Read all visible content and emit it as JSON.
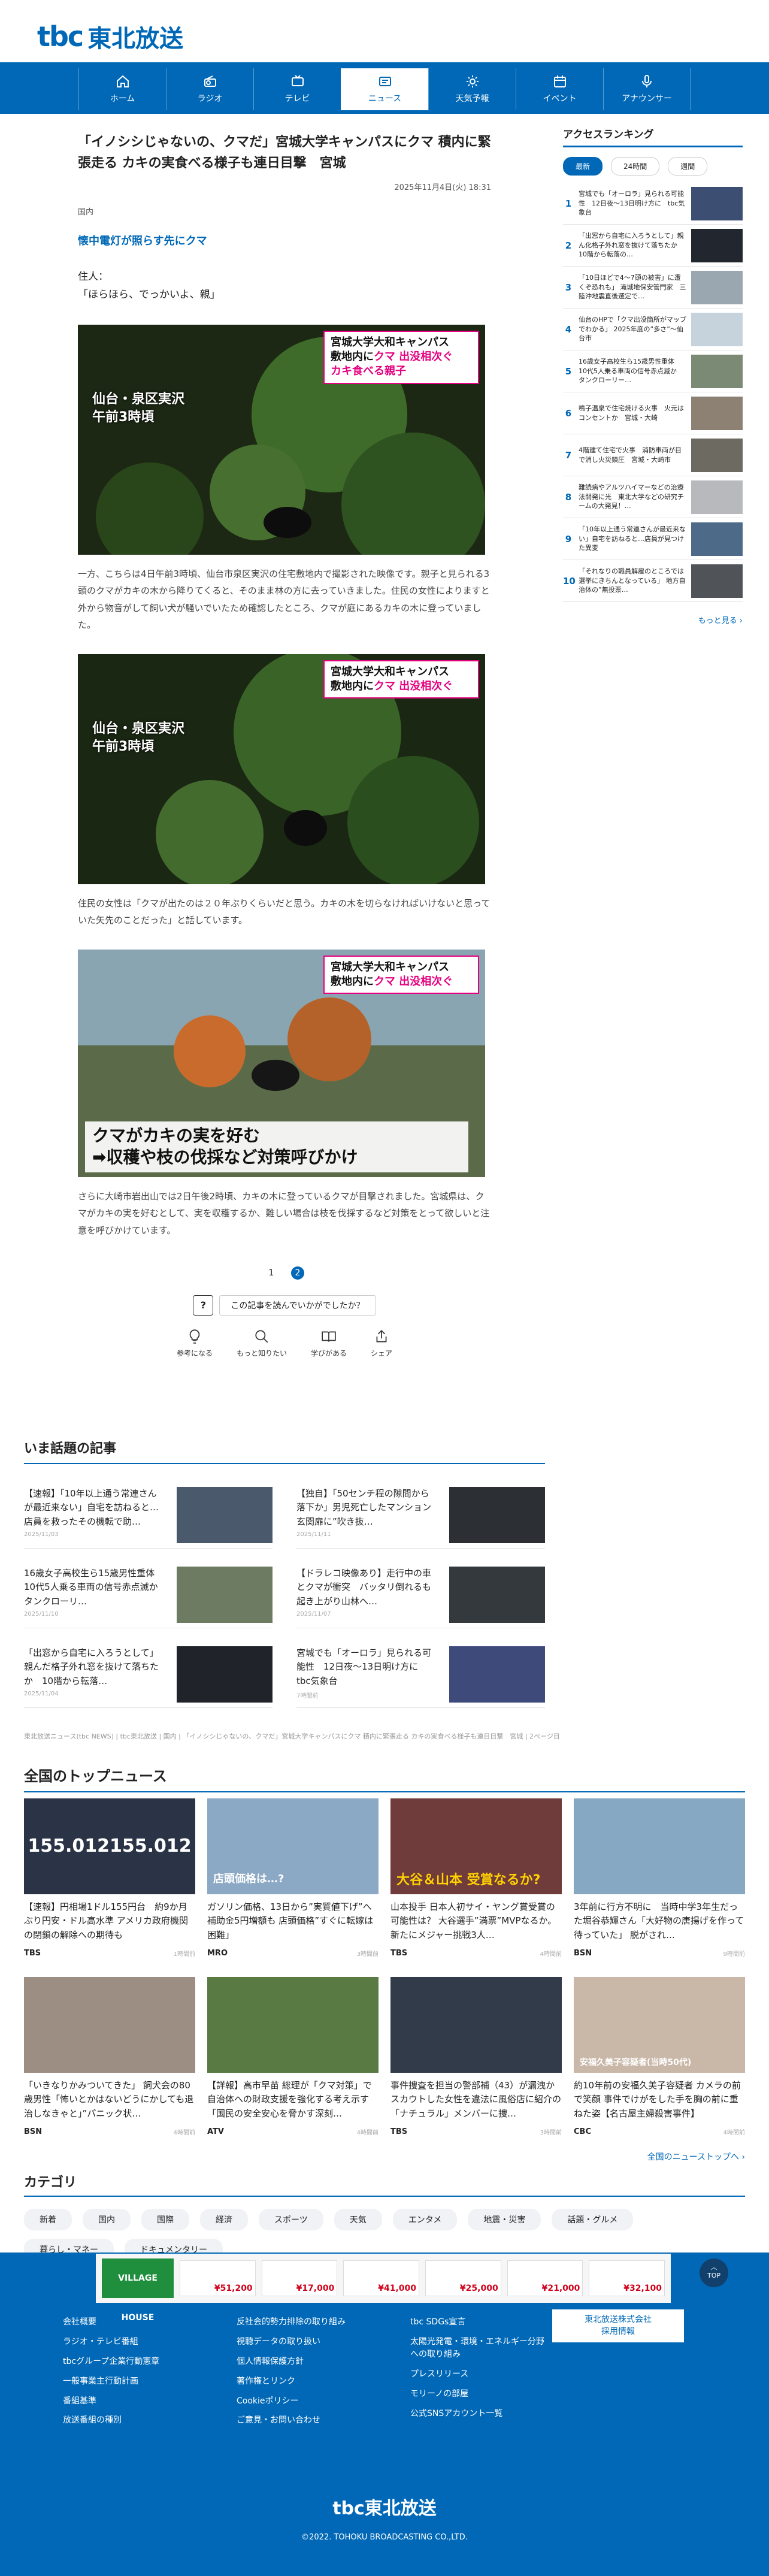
{
  "header": {
    "logo_mark": "tbc",
    "logo_text": "東北放送"
  },
  "nav": [
    {
      "label": "ホーム",
      "icon": "home-icon"
    },
    {
      "label": "ラジオ",
      "icon": "radio-icon"
    },
    {
      "label": "テレビ",
      "icon": "tv-icon"
    },
    {
      "label": "ニュース",
      "icon": "news-icon",
      "active": true
    },
    {
      "label": "天気予報",
      "icon": "weather-icon"
    },
    {
      "label": "イベント",
      "icon": "event-icon"
    },
    {
      "label": "アナウンサー",
      "icon": "mic-icon"
    }
  ],
  "article": {
    "title": "「イノシシじゃないの、クマだ」宮城大学キャンパスにクマ 積内に緊張走る カキの実食べる様子も連日目撃　宮城",
    "date": "2025年11月4日(火) 18:31",
    "category": "国内",
    "subhead": "懐中電灯が照らす先にクマ",
    "speech": "住人：\n「ほらほら、でっかいよ、親」",
    "photo_caption_1": "宮城大学大和キャンパス",
    "photo_caption_2_prefix": "敷地内に",
    "photo_caption_2_hl": "クマ 出没相次ぐ",
    "photo_caption_3": "カキ食べる親子",
    "photo_location": "仙台・泉区実沢\n午前3時頃",
    "para1": "一方、こちらは4日午前3時頃、仙台市泉区実沢の住宅敷地内で撮影された映像です。親子と見られる3頭のクマがカキの木から降りてくると、そのまま林の方に去っていきました。住民の女性によりますと外から物音がして飼い犬が騒いでいたため確認したところ、クマが庭にあるカキの木に登っていました。",
    "para2": "住民の女性は「クマが出たのは２０年ぶりくらいだと思う。カキの木を切らなければいけないと思っていた矢先のことだった」と話しています。",
    "photo3_caption": "クマがカキの実を好む\n➡収穫や枝の伐採など対策呼びかけ",
    "para3": "さらに大崎市岩出山では2日午後2時頃、カキの木に登っているクマが目撃されました。宮城県は、クマがカキの実を好むとして、実を収穫するか、難しい場合は枝を伐採するなど対策をとって欲しいと注意を呼びかけています。",
    "pages": [
      "1",
      "2"
    ],
    "ask_label": "この記事を読んでいかがでしたか？",
    "reactions": [
      {
        "label": "参考になる",
        "icon": "lightbulb-icon"
      },
      {
        "label": "もっと知りたい",
        "icon": "magnifier-icon"
      },
      {
        "label": "学びがある",
        "icon": "book-icon"
      },
      {
        "label": "シェア",
        "icon": "share-icon"
      }
    ]
  },
  "ranking": {
    "title": "アクセスランキング",
    "tabs": [
      "最新",
      "24時間",
      "週間"
    ],
    "items": [
      {
        "rank": "1",
        "text": "宮城でも「オーロラ」見られる可能性　12日夜〜13日明け方に　tbc気象台"
      },
      {
        "rank": "2",
        "text": "「出窓から自宅に入ろうとして」親ん化格子外れ窓を抜けて落ちたか　10階から転落の…"
      },
      {
        "rank": "3",
        "text": "「10日ほどで4〜7頭の被害」に遭くぞ恐れも」 滝城地保安管門家　三陸沖地震直後選定で…"
      },
      {
        "rank": "4",
        "text": "仙台のHPで「クマ出没箇所がマップでわかる」 2025年度の”多さ”〜仙台市"
      },
      {
        "rank": "5",
        "text": "16歳女子高校生ら15歳男性重体　10代5人乗る車両の信号赤点滅か　タンクローリー…"
      },
      {
        "rank": "6",
        "text": "鳴子温泉で住宅焼ける火事　火元はコンセントか　宮城・大崎"
      },
      {
        "rank": "7",
        "text": "4階建て住宅で火事　消防車両が目で消し火災鎮圧　宮城・大崎市"
      },
      {
        "rank": "8",
        "text": "難読病やアルツハイマーなどの治療法開発に光　東北大学などの研究チームの大発見！…"
      },
      {
        "rank": "9",
        "text": "「10年以上通う常連さんが最近来ない」自宅を訪ねると…店員が見つけた異変"
      },
      {
        "rank": "10",
        "text": "「それなりの職員解雇のところでは選挙にきちんとなっている」 地方自治体の”無投票…"
      }
    ],
    "more": "もっと見る ›"
  },
  "hot": {
    "title": "いま話題の記事",
    "items": [
      {
        "text": "【速報】「10年以上通う常連さんが最近来ない」自宅を訪ねると…店員を救ったその機転で助…",
        "date": "2025/11/03"
      },
      {
        "text": "【独自】「50センチ程の隙間から落下か」男児死亡したマンション 玄関扉に”吹き抜…",
        "date": "2025/11/11"
      },
      {
        "text": "16歳女子高校生ら15歳男性重体　10代5人乗る車両の信号赤点滅か　タンクローリ…",
        "date": "2025/11/10"
      },
      {
        "text": "【ドラレコ映像あり】走行中の車とクマが衝突　バッタリ倒れるも起き上がり山林へ…",
        "date": "2025/11/07"
      },
      {
        "text": "「出窓から自宅に入ろうとして」親んだ格子外れ窓を抜けて落ちたか　10階から転落…",
        "date": "2025/11/04"
      },
      {
        "text": "宮城でも「オーロラ」見られる可能性　12日夜〜13日明け方に　tbc気象台",
        "date": "7時間前"
      }
    ]
  },
  "breadcrumb": "東北放送ニュース(tbc NEWS) | tbc東北放送 | 国内 | 「イノシシじゃないの、クマだ」宮城大学キャンパスにクマ 積内に緊張走る カキの実食べる様子も連日目撃　宮城 | 2ページ目",
  "top_news": {
    "title": "全国のトップニュース",
    "items": [
      {
        "text": "【速報】円相場1ドル155円台　約9か月ぶり円安・ドル高水準 アメリカ政府機関の閉鎖の解除への期待も",
        "source": "TBS",
        "date": "1時間前",
        "thumb_text": "155.012155.012"
      },
      {
        "text": "ガソリン価格、13日から”実質値下げ”へ 補助金5円増額も 店頭価格”すぐに転嫁は困難」",
        "source": "MRO",
        "date": "3時間前",
        "thumb_text": "店頭価格は…?"
      },
      {
        "text": "山本投手 日本人初サイ・ヤング賞受賞の可能性は？ 大谷選手”満票”MVPなるか。新たにメジャー挑戦3人…",
        "source": "TBS",
        "date": "4時間前",
        "thumb_text": "大谷＆山本 受賞なるか?"
      },
      {
        "text": "3年前に行方不明に　当時中学3年生だった堀谷恭輝さん「大好物の唐揚げを作って待っていた」 脱がされ…",
        "source": "BSN",
        "date": "9時間前",
        "thumb_text": ""
      },
      {
        "text": "「いきなりかみついてきた」 飼犬会の80歳男性「怖いとかはないどうにかしても退治しなきゃと」”パニック状…",
        "source": "BSN",
        "date": "4時間前",
        "thumb_text": ""
      },
      {
        "text": "【詳報】高市早苗 総理が「クマ対策」で自治体への財政支援を強化する考え示す「国民の安全安心を脅かす深刻…",
        "source": "ATV",
        "date": "4時間前",
        "thumb_text": ""
      },
      {
        "text": "事件捜査を担当の警部補（43）が漏洩か スカウトした女性を違法に風俗店に紹介の「ナチュラル」メンバーに捜…",
        "source": "TBS",
        "date": "3時間前",
        "thumb_text": ""
      },
      {
        "text": "約10年前の安福久美子容疑者 カメラの前で笑顔 事件でけがをした手を胸の前に重ねた姿【名古屋主婦殺害事件】",
        "source": "CBC",
        "date": "4時間前",
        "thumb_text": "安福久美子容疑者(当時50代)"
      }
    ],
    "more": "全国のニューストップへ ›"
  },
  "categories": {
    "title": "カテゴリ",
    "items": [
      "新着",
      "国内",
      "国際",
      "経済",
      "スポーツ",
      "天気",
      "エンタメ",
      "地震・災害",
      "話題・グルメ",
      "暮らし・マネー",
      "ドキュメンタリー"
    ]
  },
  "ad": {
    "logo": "VILLAGE HOUSE",
    "prices": [
      "¥51,200",
      "¥17,000",
      "¥41,000",
      "¥25,000",
      "¥21,000",
      "¥32,100"
    ]
  },
  "totop": "TOP",
  "footer": {
    "col1": [
      "会社概要",
      "ラジオ・テレビ番組",
      "tbcグループ企業行動憲章",
      "一般事業主行動計画",
      "番組基準",
      "放送番組の種別"
    ],
    "col2": [
      "反社会的勢力排除の取り組み",
      "視聴データの取り扱い",
      "個人情報保護方針",
      "著作権とリンク",
      "Cookieポリシー",
      "ご意見・お問い合わせ"
    ],
    "col3": [
      "tbc SDGs宣言",
      "太陽光発電・環境・エネルギー分野への取り組み",
      "プレスリリース",
      "モリーノの部屋",
      "公式SNSアカウント一覧"
    ],
    "recruit": "東北放送株式会社\n採用情報",
    "logo": "tbc東北放送",
    "copyright": "©2022. TOHOKU BROADCASTING CO.,LTD."
  }
}
